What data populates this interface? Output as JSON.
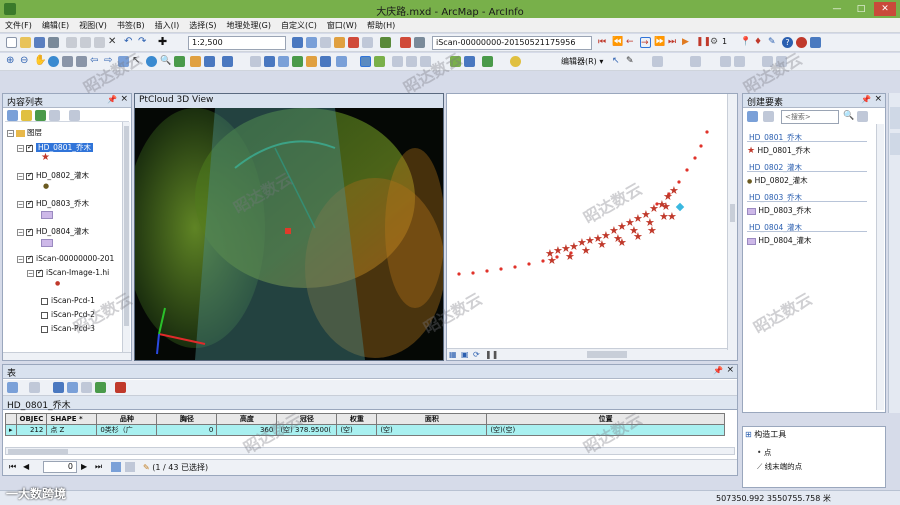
{
  "window": {
    "title": "大庆路.mxd - ArcMap - ArcInfo",
    "controls": [
      "—",
      "□",
      "✕"
    ]
  },
  "menu": [
    "文件(F)",
    "编辑(E)",
    "视图(V)",
    "书签(B)",
    "插入(I)",
    "选择(S)",
    "地理处理(G)",
    "自定义(C)",
    "窗口(W)",
    "帮助(H)"
  ],
  "toolbar1": {
    "scale": "1:2,500",
    "iscan_combo": "iScan-00000000-20150521175956",
    "frame_number": "1"
  },
  "toolbar2": {
    "editor_label": "编辑器(R) ▾"
  },
  "toc": {
    "title": "内容列表",
    "root": "图层",
    "layers": [
      {
        "name": "HD_0801_乔木",
        "checked": true,
        "selected": true
      },
      {
        "name": "HD_0802_灌木",
        "checked": true,
        "selected": false
      },
      {
        "name": "HD_0803_乔木",
        "checked": true,
        "selected": false
      },
      {
        "name": "HD_0804_灌木",
        "checked": true,
        "selected": false
      },
      {
        "name": "iScan-00000000-201",
        "checked": true,
        "selected": false
      },
      {
        "name": "iScan-Image-1.hi",
        "checked": true,
        "selected": false
      },
      {
        "name": "iScan-Pcd-1",
        "checked": false,
        "selected": false
      },
      {
        "name": "iScan-Pcd-2",
        "checked": false,
        "selected": false
      },
      {
        "name": "iScan-Pcd-3",
        "checked": false,
        "selected": false
      }
    ]
  },
  "view3d": {
    "title": "PtCloud 3D View"
  },
  "create_features": {
    "title": "创建要素",
    "search_placeholder": "<搜索>",
    "groups": [
      {
        "header": "HD_0801_乔木",
        "item": "HD_0801_乔木"
      },
      {
        "header": "HD_0802_灌木",
        "item": "HD_0802_灌木"
      },
      {
        "header": "HD_0803_乔木",
        "item": "HD_0803_乔木"
      },
      {
        "header": "HD_0804_灌木",
        "item": "HD_0804_灌木"
      }
    ],
    "construction_tools_title": "构造工具",
    "construction_items": [
      "点",
      "线末端的点"
    ]
  },
  "table_window": {
    "title": "表",
    "layer_tab": "HD_0801_乔木",
    "columns": [
      "OBJEC",
      "SHAPE *",
      "品种",
      "胸径",
      "高度",
      "冠径",
      "权重",
      "面积",
      "位置"
    ],
    "rows": [
      [
        "212",
        "点 Z",
        "0类杉（广",
        "0",
        "360",
        "(空) 378.9500(",
        "(空)",
        "(空)",
        "(空)(空)"
      ]
    ],
    "record_index": "0",
    "selection_status": "(1 / 43 已选择)"
  },
  "statusbar": {
    "coordinates": "507350.992  3550755.758 米"
  },
  "overlay_text": {
    "watermark": "昭达数云",
    "corner_logo": "一大数跨境"
  },
  "colors": {
    "title_green": "#78b04a",
    "selection_blue": "#3074d9",
    "feature_red": "#c0392b",
    "table_row_cyan": "#a9f0f0"
  }
}
